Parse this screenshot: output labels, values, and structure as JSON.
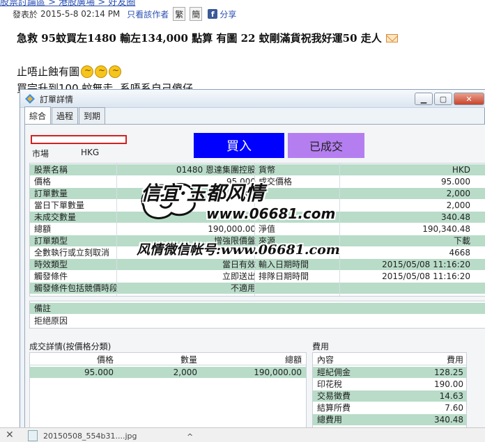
{
  "post": {
    "top_link": "股票討論區 > 港股廣場 > 好友圈",
    "meta_label": "發表於",
    "date": "2015-5-8 02:14 PM",
    "author_only": "只看該作者",
    "traditional": "繁",
    "simplified": "簡",
    "share": "分享",
    "title": "急救 95蚊買左1480 輸左134,000 點算 有圖 22 蚊剛滿貨祝我好運50 走人",
    "line1": "止唔止蝕有圖",
    "line2": "買完升到100 蚊無走..系唔系自己傻仔"
  },
  "window": {
    "title": "訂單詳情",
    "tabs": [
      "綜合",
      "過程",
      "到期"
    ],
    "min": "▁",
    "max": "▢",
    "close": "✕"
  },
  "order": {
    "market_label": "市場",
    "market_value": "HKG",
    "buy_label": "買入",
    "status_label": "已成交",
    "rows": [
      {
        "l1": "股票名稱",
        "v1": "01480 恩達集團控股",
        "l2": "貨幣",
        "v2": "HKD",
        "bg": "g"
      },
      {
        "l1": "價格",
        "v1": "95.000",
        "l2": "成交價格",
        "v2": "95.000",
        "bg": "w"
      },
      {
        "l1": "訂單數量",
        "v1": "2,000",
        "l2": "",
        "v2": "2,000",
        "bg": "g"
      },
      {
        "l1": "當日下單數量",
        "v1": "",
        "l2": "",
        "v2": "2,000",
        "bg": "w"
      },
      {
        "l1": "未成交數量",
        "v1": "",
        "l2": "",
        "v2": "340.48",
        "bg": "g"
      },
      {
        "l1": "總額",
        "v1": "190,000.00",
        "l2": "淨值",
        "v2": "190,340.48",
        "bg": "w"
      },
      {
        "l1": "訂單類型",
        "v1": "增強限價盤",
        "l2": "來源",
        "v2": "下載",
        "bg": "g"
      },
      {
        "l1": "全數執行或立刻取消",
        "v1": "",
        "l2": "",
        "v2": "4668",
        "bg": "w"
      },
      {
        "l1": "時效類型",
        "v1": "當日有效",
        "l2": "輸入日期時間",
        "v2": "2015/05/08 11:16:20",
        "bg": "g"
      },
      {
        "l1": "觸發條件",
        "v1": "立即送出",
        "l2": "排隊日期時間",
        "v2": "2015/05/08 11:16:20",
        "bg": "w"
      },
      {
        "l1": "觸發條件包括競價時段",
        "v1": "不適用",
        "l2": "",
        "v2": "",
        "bg": "g"
      }
    ],
    "note_label": "備註",
    "reject_label": "拒絕原因"
  },
  "fills": {
    "title": "成交詳情(按價格分類)",
    "headers": [
      "價格",
      "數量",
      "總額"
    ],
    "rows": [
      [
        "95.000",
        "2,000",
        "190,000.00"
      ]
    ]
  },
  "fees": {
    "title": "費用",
    "headers": [
      "內容",
      "費用"
    ],
    "rows": [
      {
        "name": "經紀佣金",
        "value": "128.25",
        "bg": "g"
      },
      {
        "name": "印花稅",
        "value": "190.00",
        "bg": "w"
      },
      {
        "name": "交易徵費",
        "value": "14.63",
        "bg": "g"
      },
      {
        "name": "結算所費",
        "value": "7.60",
        "bg": "w"
      },
      {
        "name": "總費用",
        "value": "340.48",
        "bg": "g"
      }
    ]
  },
  "watermark": {
    "line1": "信宜·玉都风情",
    "line2": "www.06681.com",
    "line3": "风情微信帐号:www.06681.com"
  },
  "bottom": {
    "close": "✕",
    "file": "20150508_554b31....jpg",
    "chevron": "^"
  },
  "colors": {
    "buy": "#0000ff",
    "filled": "#b47ef0",
    "row_green": "#b8dcc8",
    "highlight_border": "#d32020"
  }
}
